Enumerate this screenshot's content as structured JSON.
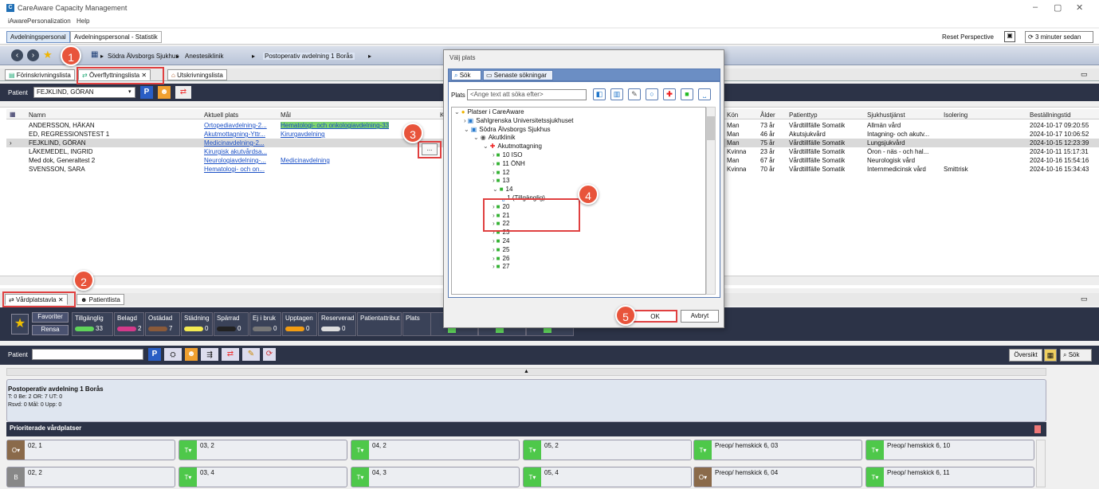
{
  "window": {
    "title": "CareAware Capacity Management",
    "min": "–",
    "restore": "▢",
    "close": "✕"
  },
  "menu": [
    "iAware",
    "Personalization",
    "Help"
  ],
  "perspective_tabs": [
    "Avdelningspersonal",
    "Avdelningspersonal - Statistik"
  ],
  "toolbar": {
    "reset": "Reset Perspective",
    "refresh": "3 minuter sedan"
  },
  "breadcrumb": [
    "Södra Älvsborgs Sjukhus",
    "Anestesiklinik",
    "Postoperativ avdelning 1 Borås"
  ],
  "doc_tabs": [
    "Förinskrivningslista",
    "Överflyttningslista",
    "Utskrivningslista"
  ],
  "patient_bar": {
    "label": "Patient",
    "value": "FEJKLIND, GÖRAN"
  },
  "grid": {
    "headers_left": [
      "Namn",
      "Aktuell plats",
      "Mål",
      "K"
    ],
    "headers_right": [
      "Kön",
      "Ålder",
      "Patienttyp",
      "Sjukhustjänst",
      "Isolering",
      "Beställningstid"
    ],
    "rows": [
      {
        "name": "ANDERSSON, HÅKAN",
        "current": "Ortopediavdelning-2...",
        "goal": "Hematologi- och onkologiavdelning-33",
        "sex": "Man",
        "age": "73 år",
        "type": "Vårdtillfälle Somatik",
        "service": "Allmän vård",
        "iso": "",
        "time": "2024-10-17 09:20:55"
      },
      {
        "name": "ED, REGRESSIONSTEST 1",
        "current": "Akutmottagning-Yttr...",
        "goal": "Kirurgavdelning",
        "sex": "Man",
        "age": "46 år",
        "type": "Akutsjukvård",
        "service": "Intagning- och akutv...",
        "iso": "",
        "time": "2024-10-17 10:06:52"
      },
      {
        "name": "FEJKLIND, GÖRAN",
        "current": "Medicinavdelning-2...",
        "goal": "",
        "sex": "Man",
        "age": "75 år",
        "type": "Vårdtillfälle Somatik",
        "service": "Lungsjukvård",
        "iso": "",
        "time": "2024-10-15 12:23:39"
      },
      {
        "name": "LÄKEMEDEL, INGRID",
        "current": "Kirurgisk akutvårdsa...",
        "goal": "",
        "sex": "Kvinna",
        "age": "23 år",
        "type": "Vårdtillfälle Somatik",
        "service": "Öron - näs - och hal...",
        "iso": "",
        "time": "2024-10-11 15:17:31"
      },
      {
        "name": "Med dok, Generaltest 2",
        "current": "Neurologiavdelning-...",
        "goal": "Medicinavdelning",
        "sex": "Man",
        "age": "67 år",
        "type": "Vårdtillfälle Somatik",
        "service": "Neurologisk vård",
        "iso": "",
        "time": "2024-10-16 15:54:16"
      },
      {
        "name": "SVENSSON, SARA",
        "current": "Hematologi- och on...",
        "goal": "",
        "sex": "Kvinna",
        "age": "70 år",
        "type": "Vårdtillfälle Somatik",
        "service": "Internmedicinsk vård",
        "iso": "Smittrisk",
        "time": "2024-10-16 15:34:43"
      }
    ],
    "ellipsis": "..."
  },
  "bottom_tabs": [
    "Vårdplatstavla",
    "Patientlista"
  ],
  "status": {
    "favoriter": "Favoriter",
    "rensa": "Rensa",
    "groups": [
      {
        "label": "Tillgänglig",
        "count": "33",
        "color": "#5fd35a"
      },
      {
        "label": "Belagd",
        "count": "2",
        "color": "#d33a8a"
      },
      {
        "label": "Ostädad",
        "count": "7",
        "color": "#8a5a3a"
      },
      {
        "label": "Städning",
        "count": "0",
        "color": "#f3ea52"
      },
      {
        "label": "Spärrad",
        "count": "0",
        "color": "#222222"
      },
      {
        "label": "Ej i bruk",
        "count": "0",
        "color": "#777777"
      },
      {
        "label": "Upptagen",
        "count": "0",
        "color": "#f39c12"
      },
      {
        "label": "Reserverad",
        "count": "0",
        "color": "#dddddd"
      },
      {
        "label": "Patientattribut",
        "count": "",
        "color": ""
      },
      {
        "label": "Plats",
        "count": "",
        "color": ""
      }
    ]
  },
  "patient_bar2": {
    "label": "Patient",
    "oversikt": "Översikt",
    "sok": "Sök"
  },
  "ward": {
    "name": "Postoperativ avdelning 1 Borås",
    "line1": "T: 0 Be: 2 OR: 7 UT: 0",
    "line2": "Rsvd: 0 Mål: 0 Upp: 0"
  },
  "prio_header": "Prioriterade vårdplatser",
  "beds_row1": [
    {
      "tag": "O▾",
      "label": "02, 1",
      "color": "#8a6a4a"
    },
    {
      "tag": "T▾",
      "label": "03, 2",
      "color": "#4ec84a"
    },
    {
      "tag": "T▾",
      "label": "04, 2",
      "color": "#4ec84a"
    },
    {
      "tag": "T▾",
      "label": "05, 2",
      "color": "#4ec84a"
    },
    {
      "tag": "T▾",
      "label": "Preop/ hemskick 6, 03",
      "color": "#4ec84a"
    },
    {
      "tag": "T▾",
      "label": "Preop/ hemskick 6, 10",
      "color": "#4ec84a"
    }
  ],
  "beds_row2": [
    {
      "tag": "B",
      "label": "02, 2",
      "color": "#888888"
    },
    {
      "tag": "T▾",
      "label": "03, 4",
      "color": "#4ec84a"
    },
    {
      "tag": "T▾",
      "label": "04, 3",
      "color": "#4ec84a"
    },
    {
      "tag": "T▾",
      "label": "05, 4",
      "color": "#4ec84a"
    },
    {
      "tag": "O▾",
      "label": "Preop/ hemskick 6, 04",
      "color": "#8a6a4a"
    },
    {
      "tag": "T▾",
      "label": "Preop/ hemskick 6, 11",
      "color": "#4ec84a"
    }
  ],
  "dialog": {
    "title": "Välj plats",
    "tabs": [
      "Sök",
      "Senaste sökningar"
    ],
    "plats_label": "Plats",
    "placeholder": "<Ange text att söka efter>",
    "tree": [
      {
        "label": "Platser i CareAware",
        "indent": 0,
        "icon": "globe"
      },
      {
        "label": "Sahlgrenska Universitetssjukhuset",
        "indent": 1,
        "icon": "hospital"
      },
      {
        "label": "Södra Älvsborgs Sjukhus",
        "indent": 1,
        "icon": "hospital"
      },
      {
        "label": "Akutklinik",
        "indent": 2,
        "icon": "clinic"
      },
      {
        "label": "Akutmottagning",
        "indent": 3,
        "icon": "cross"
      },
      {
        "label": "10 ISO",
        "indent": 4,
        "icon": "room"
      },
      {
        "label": "11 ÖNH",
        "indent": 4,
        "icon": "room"
      },
      {
        "label": "12",
        "indent": 4,
        "icon": "room"
      },
      {
        "label": "13",
        "indent": 4,
        "icon": "room"
      },
      {
        "label": "14",
        "indent": 4,
        "icon": "room"
      },
      {
        "label": "1 (Tillgänglig)",
        "indent": 5,
        "icon": "bed"
      },
      {
        "label": "20",
        "indent": 4,
        "icon": "room"
      },
      {
        "label": "21",
        "indent": 4,
        "icon": "room"
      },
      {
        "label": "22",
        "indent": 4,
        "icon": "room"
      },
      {
        "label": "23",
        "indent": 4,
        "icon": "room"
      },
      {
        "label": "24",
        "indent": 4,
        "icon": "room"
      },
      {
        "label": "25",
        "indent": 4,
        "icon": "room"
      },
      {
        "label": "26",
        "indent": 4,
        "icon": "room"
      },
      {
        "label": "27",
        "indent": 4,
        "icon": "room"
      }
    ],
    "ok": "OK",
    "cancel": "Avbryt"
  },
  "callouts": [
    "1",
    "2",
    "3",
    "4",
    "5"
  ]
}
